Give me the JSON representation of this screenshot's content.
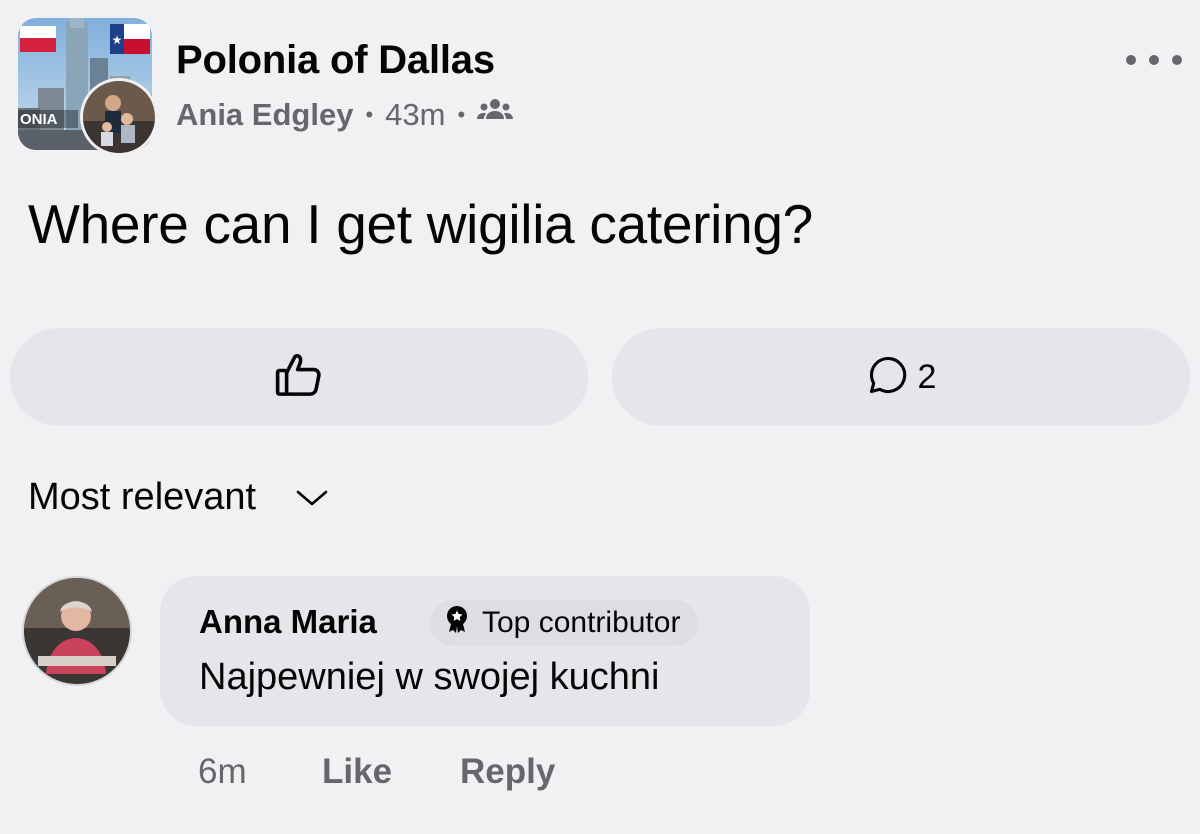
{
  "post": {
    "group_name": "Polonia of Dallas",
    "author": "Ania Edgley",
    "separator": "•",
    "time": "43m",
    "privacy_icon": "members-icon",
    "group_avatar_label": "ONIA",
    "text": "Where can I get wigilia catering?"
  },
  "actions": {
    "like_icon": "thumbs-up-icon",
    "comment_icon": "comment-bubble-icon",
    "comment_count": "2"
  },
  "sort": {
    "label": "Most relevant"
  },
  "comment": {
    "name": "Anna Maria",
    "badge": "Top contributor",
    "text": "Najpewniej w swojej kuchni",
    "time": "6m",
    "like_label": "Like",
    "reply_label": "Reply"
  },
  "colors": {
    "background": "#f1f1f3",
    "button_bg": "#e4e6ea",
    "secondary_text": "#65676b"
  }
}
